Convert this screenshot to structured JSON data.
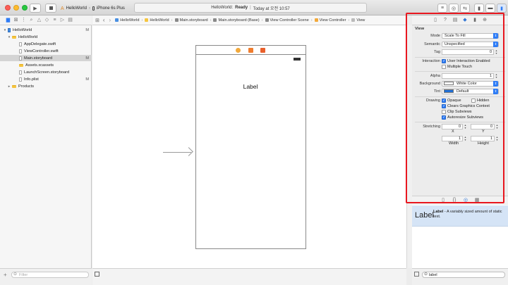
{
  "titlebar": {
    "scheme_app": "HelloWorld",
    "scheme_device": "iPhone 6s Plus",
    "status_app": "HelloWorld:",
    "status_state": "Ready",
    "status_time": "Today at 오전 10:57"
  },
  "navigator": {
    "items": [
      {
        "label": "HelloWorld",
        "flag": "M",
        "kind": "project",
        "level": 0,
        "selected": false
      },
      {
        "label": "HelloWorld",
        "flag": "",
        "kind": "folder",
        "level": 1,
        "selected": false
      },
      {
        "label": "AppDelegate.swift",
        "flag": "",
        "kind": "file",
        "level": 2,
        "selected": false
      },
      {
        "label": "ViewController.swift",
        "flag": "",
        "kind": "file",
        "level": 2,
        "selected": false
      },
      {
        "label": "Main.storyboard",
        "flag": "M",
        "kind": "file",
        "level": 2,
        "selected": true
      },
      {
        "label": "Assets.xcassets",
        "flag": "",
        "kind": "folder",
        "level": 2,
        "selected": false
      },
      {
        "label": "LaunchScreen.storyboard",
        "flag": "",
        "kind": "file",
        "level": 2,
        "selected": false
      },
      {
        "label": "Info.plist",
        "flag": "M",
        "kind": "file",
        "level": 2,
        "selected": false
      },
      {
        "label": "Products",
        "flag": "",
        "kind": "folder",
        "level": 1,
        "selected": false
      }
    ],
    "filter_placeholder": "Filter"
  },
  "jumpbar": {
    "crumbs": [
      "HelloWorld",
      "HelloWorld",
      "Main.storyboard",
      "Main.storyboard (Base)",
      "View Controller Scene",
      "View Controller",
      "View"
    ]
  },
  "canvas": {
    "label_text": "Label"
  },
  "inspector": {
    "section": "View",
    "mode_label": "Mode",
    "mode_value": "Scale To Fill",
    "semantic_label": "Semantic",
    "semantic_value": "Unspecified",
    "tag_label": "Tag",
    "tag_value": "0",
    "interaction_label": "Interaction",
    "user_interaction": "User Interaction Enabled",
    "multiple_touch": "Multiple Touch",
    "alpha_label": "Alpha",
    "alpha_value": "1",
    "background_label": "Background",
    "background_value": "White Color",
    "tint_label": "Tint",
    "tint_value": "Default",
    "drawing_label": "Drawing",
    "opaque": "Opaque",
    "hidden": "Hidden",
    "clears": "Clears Graphics Context",
    "clip": "Clip Subviews",
    "autoresize": "Autoresize Subviews",
    "stretching_label": "Stretching",
    "stretch_x": "0",
    "stretch_y": "0",
    "stretch_w": "1",
    "stretch_h": "1",
    "x_label": "X",
    "y_label": "Y",
    "width_label": "Width",
    "height_label": "Height"
  },
  "library": {
    "big_label": "Label",
    "item_title": "Label",
    "item_desc": " - A variably sized amount of static text.",
    "search_value": "label"
  },
  "colors": {
    "accent": "#2e7cf6",
    "highlight": "#e8171f",
    "tint_swatch": "#1f6fd6"
  }
}
